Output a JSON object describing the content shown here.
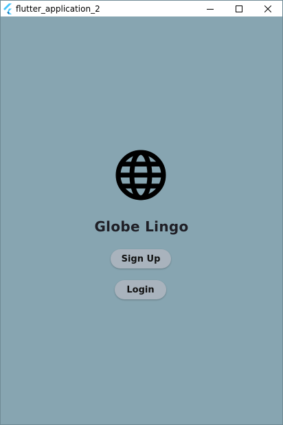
{
  "window": {
    "title": "flutter_application_2",
    "app_icon": "flutter-logo-icon",
    "controls": {
      "minimize_icon": "minimize-icon",
      "maximize_icon": "maximize-icon",
      "close_icon": "close-icon"
    }
  },
  "main": {
    "logo_icon": "globe-icon",
    "title": "Globe Lingo",
    "signup_label": "Sign Up",
    "login_label": "Login"
  },
  "colors": {
    "background": "#87a5b1",
    "button_bg": "#a9b3bd",
    "title_text": "#1f1f26"
  }
}
